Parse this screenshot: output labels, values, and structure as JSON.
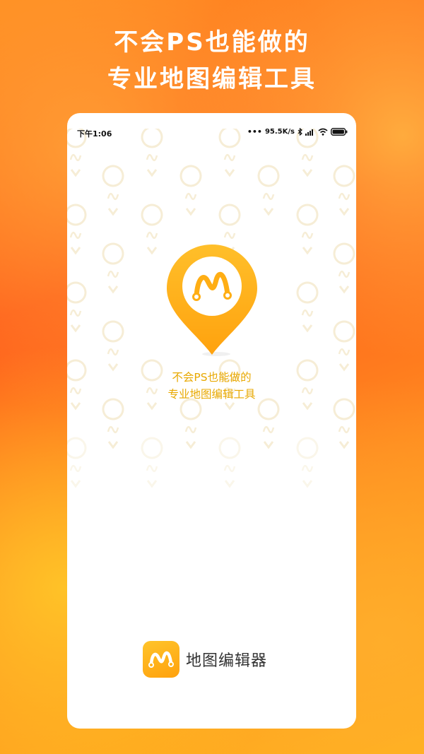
{
  "promo": {
    "line1": "不会PS也能做的",
    "line2": "专业地图编辑工具"
  },
  "status_bar": {
    "time": "下午1:06",
    "network_speed": "95.5K/s",
    "icons": [
      "more-dots-icon",
      "bluetooth-icon",
      "signal-icon",
      "wifi-icon",
      "battery-icon"
    ]
  },
  "splash": {
    "logo_icon": "map-pin-logo-icon",
    "slogan_line1": "不会PS也能做的",
    "slogan_line2": "专业地图编辑工具"
  },
  "brand": {
    "app_icon": "app-logo-icon",
    "app_name": "地图编辑器"
  },
  "colors": {
    "accent": "#FFB21C",
    "slogan": "#E8A800",
    "headline": "#FFFFFF"
  }
}
